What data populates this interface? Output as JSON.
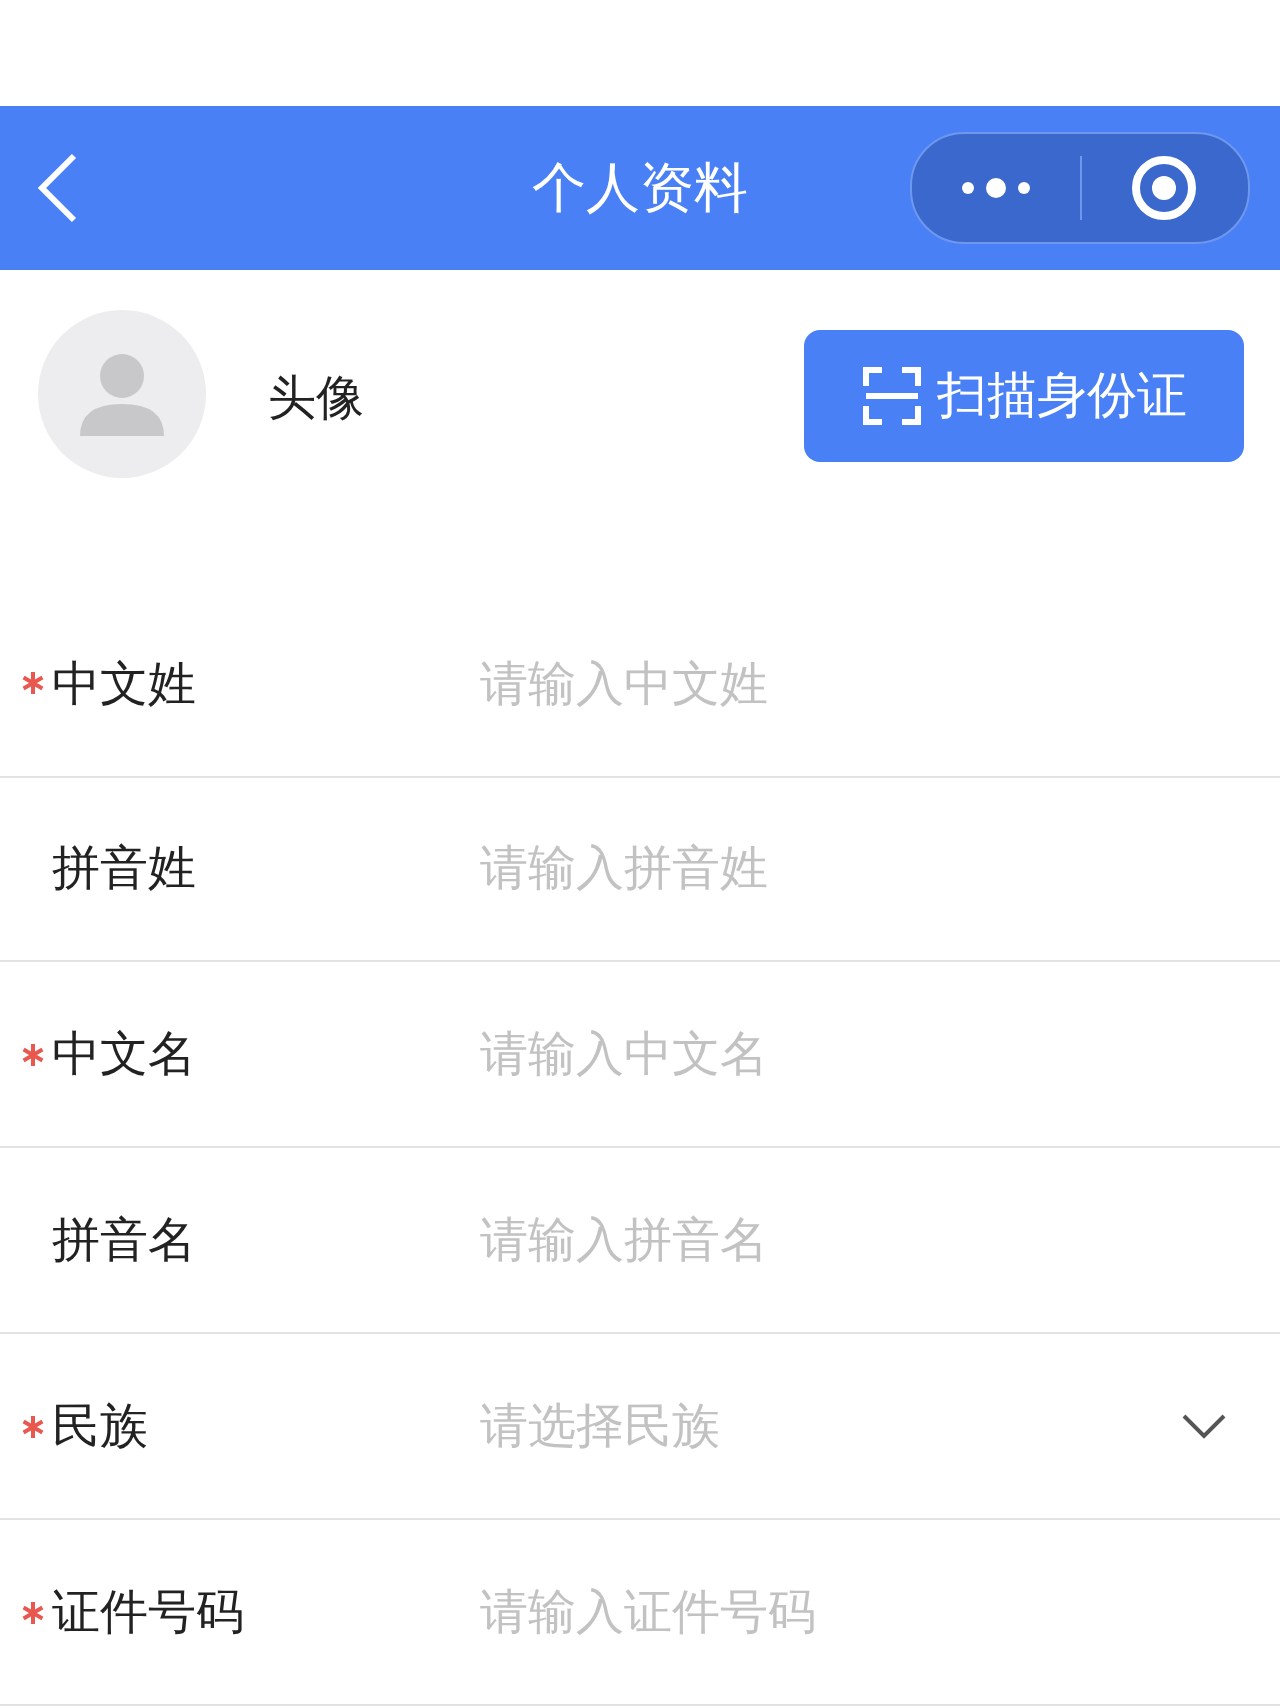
{
  "nav_bar": {
    "title": "个人资料"
  },
  "profile": {
    "avatar_label": "头像",
    "scan_button": "扫描身份证"
  },
  "fields": [
    {
      "kind": "input",
      "label": "中文姓",
      "placeholder": "请输入中文姓",
      "required": true
    },
    {
      "kind": "input",
      "label": "拼音姓",
      "placeholder": "请输入拼音姓",
      "required": false
    },
    {
      "kind": "input",
      "label": "中文名",
      "placeholder": "请输入中文名",
      "required": true
    },
    {
      "kind": "input",
      "label": "拼音名",
      "placeholder": "请输入拼音名",
      "required": false
    },
    {
      "kind": "select",
      "label": "民族",
      "placeholder": "请选择民族",
      "required": true
    },
    {
      "kind": "input",
      "label": "证件号码",
      "placeholder": "请输入证件号码",
      "required": true
    }
  ]
}
